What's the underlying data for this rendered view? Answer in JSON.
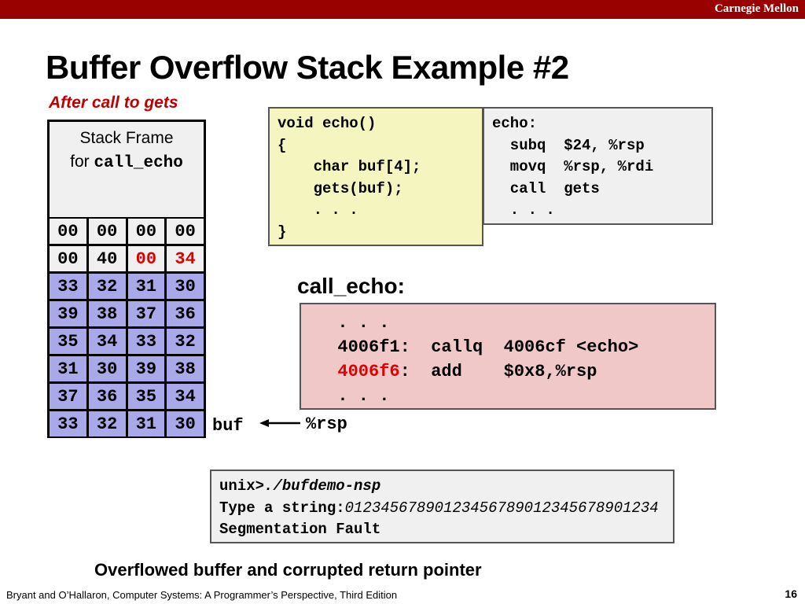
{
  "header": {
    "brand": "Carnegie Mellon",
    "title": "Buffer Overflow Stack Example #2",
    "subtitle": "After call to gets"
  },
  "colors": {
    "bar": "#990000",
    "accent": "#c00000",
    "buffer": "#a9a9e9",
    "c_code_bg": "#f5f5c0",
    "call_echo_bg": "#f0c8c8"
  },
  "stack": {
    "frame_label_1": "Stack Frame",
    "frame_label_2_prefix": "for ",
    "frame_label_2_code": "call_echo",
    "rows": [
      [
        {
          "v": "00"
        },
        {
          "v": "00"
        },
        {
          "v": "00"
        },
        {
          "v": "00"
        }
      ],
      [
        {
          "v": "00"
        },
        {
          "v": "40"
        },
        {
          "v": "00",
          "red": true
        },
        {
          "v": "34",
          "red": true
        }
      ],
      [
        {
          "v": "33"
        },
        {
          "v": "32"
        },
        {
          "v": "31"
        },
        {
          "v": "30"
        }
      ],
      [
        {
          "v": "39"
        },
        {
          "v": "38"
        },
        {
          "v": "37"
        },
        {
          "v": "36"
        }
      ],
      [
        {
          "v": "35"
        },
        {
          "v": "34"
        },
        {
          "v": "33"
        },
        {
          "v": "32"
        }
      ],
      [
        {
          "v": "31"
        },
        {
          "v": "30"
        },
        {
          "v": "39"
        },
        {
          "v": "38"
        }
      ],
      [
        {
          "v": "37"
        },
        {
          "v": "36"
        },
        {
          "v": "35"
        },
        {
          "v": "34"
        }
      ],
      [
        {
          "v": "33"
        },
        {
          "v": "32"
        },
        {
          "v": "31"
        },
        {
          "v": "30"
        }
      ]
    ],
    "buf_label": "buf",
    "rsp_label": "%rsp"
  },
  "c_code": "void echo()\n{\n    char buf[4];\n    gets(buf);\n    . . .\n}",
  "echo_asm": "echo:\n  subq  $24, %rsp\n  movq  %rsp, %rdi\n  call  gets\n  . . .",
  "call_echo": {
    "label": "call_echo:",
    "line1": "  . . .",
    "line2_addr": "  4006f1",
    "line2_rest": ":  callq  4006cf <echo>",
    "line3_addr": "  4006f6",
    "line3_rest": ":  add    $0x8,%rsp",
    "line4": "  . . ."
  },
  "terminal": {
    "prompt": "unix>",
    "cmd": "./bufdemo-nsp",
    "line2_label": "Type a string:",
    "line2_input": "01234567890123456789012345678901234",
    "line3": "Segmentation Fault"
  },
  "caption": "Overflowed buffer and corrupted return pointer",
  "footer": {
    "citation": "Bryant and O’Hallaron, Computer Systems: A Programmer’s Perspective, Third Edition",
    "page": "16"
  }
}
